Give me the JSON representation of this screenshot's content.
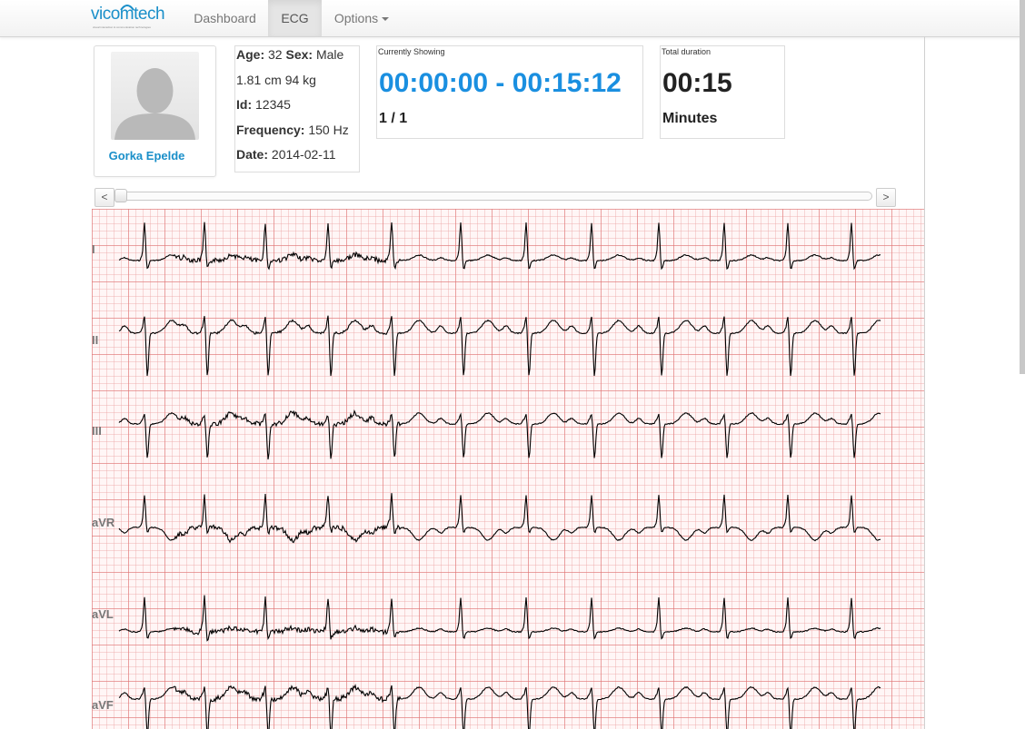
{
  "brand": {
    "name": "vicomtech",
    "tagline": "visual interaction & communication technologies"
  },
  "nav": {
    "items": [
      "Dashboard",
      "ECG",
      "Options"
    ],
    "active": "ECG"
  },
  "patient": {
    "name": "Gorka Epelde",
    "age_label": "Age:",
    "age": "32",
    "sex_label": "Sex:",
    "sex": "Male",
    "height_weight": "1.81 cm 94 kg",
    "id_label": "Id:",
    "id": "12345",
    "frequency_label": "Frequency:",
    "frequency": "150 Hz",
    "date_label": "Date:",
    "date": "2014-02-11"
  },
  "showing": {
    "label": "Currently Showing",
    "range": "00:00:00 - 00:15:12",
    "page": "1 / 1"
  },
  "duration": {
    "label": "Total duration",
    "value": "00:15",
    "unit": "Minutes"
  },
  "slider": {
    "prev": "<",
    "next": ">",
    "position": 0
  },
  "ecg": {
    "leads": [
      "I",
      "II",
      "III",
      "aVR",
      "aVL",
      "aVF"
    ],
    "paper_color": "#fff6f6",
    "trace_color": "#000000",
    "beats_per_strip": 12
  },
  "colors": {
    "accent": "#1a8fe0",
    "link": "#1a8fc9"
  }
}
